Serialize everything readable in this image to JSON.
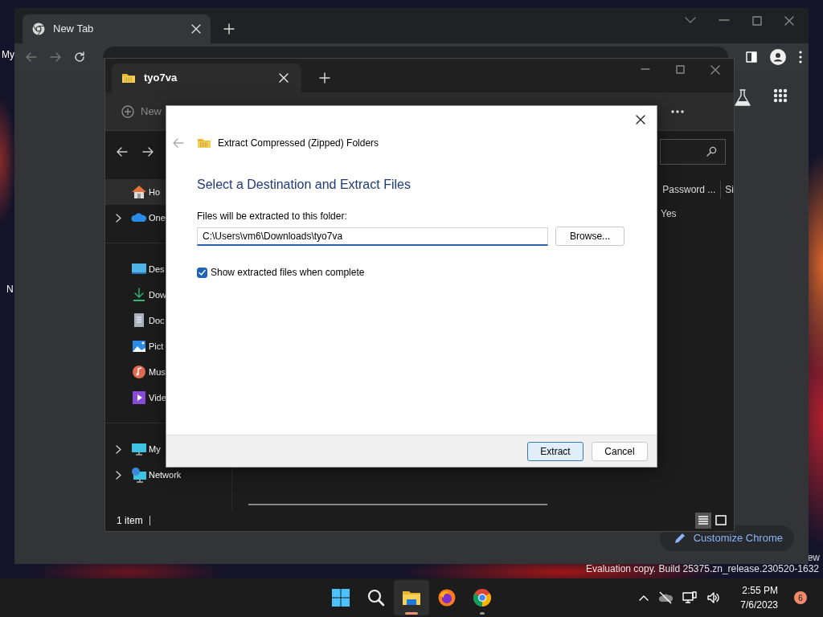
{
  "desktop": {
    "labels": [
      "My",
      "N",
      "ew"
    ],
    "evaluation_notice": "Evaluation copy. Build 25375.zn_release.230520-1632"
  },
  "browser": {
    "tabs": [
      {
        "label": "New Tab",
        "selected": true
      }
    ],
    "customize_button": "Customize Chrome"
  },
  "explorer": {
    "tabs": [
      {
        "label": "tyo7va",
        "selected": true
      }
    ],
    "toolbar_new": "New",
    "nav_groups": [
      [
        {
          "kind": "home",
          "label": "Ho",
          "selected": true,
          "expandable": false
        },
        {
          "kind": "cloud",
          "label": "One",
          "selected": false,
          "expandable": true
        }
      ],
      [
        {
          "kind": "desktop",
          "label": "Des",
          "selected": false,
          "expandable": false
        },
        {
          "kind": "downloads",
          "label": "Dow",
          "selected": false,
          "expandable": false
        },
        {
          "kind": "documents",
          "label": "Doc",
          "selected": false,
          "expandable": false
        },
        {
          "kind": "pictures",
          "label": "Pict",
          "selected": false,
          "expandable": false
        },
        {
          "kind": "music",
          "label": "Mus",
          "selected": false,
          "expandable": false
        },
        {
          "kind": "videos",
          "label": "Vide",
          "selected": false,
          "expandable": false
        }
      ],
      [
        {
          "kind": "pc",
          "label": "My",
          "selected": false,
          "expandable": true
        },
        {
          "kind": "network",
          "label": "Network",
          "selected": false,
          "expandable": true
        }
      ]
    ],
    "columns": [
      "Password ...",
      "Si"
    ],
    "rows": [
      [
        "Yes"
      ]
    ],
    "status": "1 item",
    "view_modes": [
      {
        "kind": "details",
        "selected": true
      },
      {
        "kind": "tiles",
        "selected": false
      }
    ]
  },
  "dialog": {
    "title": "Extract Compressed (Zipped) Folders",
    "heading": "Select a Destination and Extract Files",
    "folder_label": "Files will be extracted to this folder:",
    "folder_path": "C:\\Users\\vm6\\Downloads\\tyo7va",
    "browse_button": "Browse...",
    "show_files": {
      "label": "Show extracted files when complete",
      "checked": true
    },
    "buttons": [
      {
        "label": "Extract",
        "default": true
      },
      {
        "label": "Cancel",
        "default": false
      }
    ]
  },
  "taskbar": {
    "apps": [
      {
        "kind": "start",
        "open": false,
        "selected": false
      },
      {
        "kind": "search",
        "open": false,
        "selected": false
      },
      {
        "kind": "explorer",
        "open": true,
        "selected": true
      },
      {
        "kind": "firefox",
        "open": false,
        "selected": false
      },
      {
        "kind": "chrome",
        "open": true,
        "selected": false
      }
    ],
    "time": "2:55 PM",
    "date": "7/6/2023",
    "notifications": "6"
  }
}
